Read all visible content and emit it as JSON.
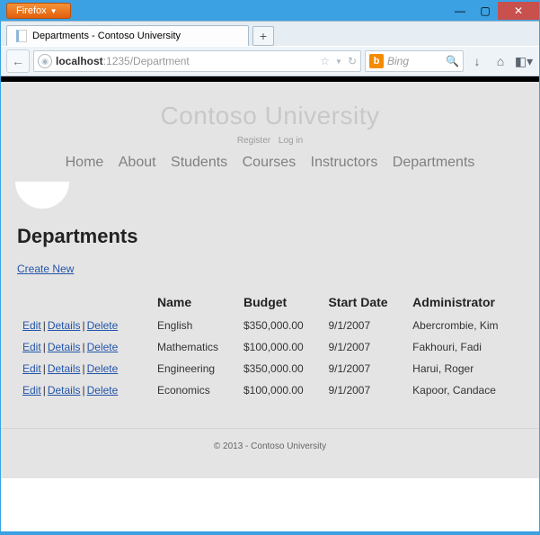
{
  "browser": {
    "menu_label": "Firefox",
    "tab_title": "Departments - Contoso University",
    "url_host": "localhost",
    "url_path": ":1235/Department",
    "search_placeholder": "Bing",
    "newtab_label": "+"
  },
  "site": {
    "title": "Contoso University",
    "auth": {
      "register": "Register",
      "login": "Log in"
    },
    "nav": [
      "Home",
      "About",
      "Students",
      "Courses",
      "Instructors",
      "Departments"
    ]
  },
  "page": {
    "heading": "Departments",
    "create_label": "Create New",
    "columns": [
      "Name",
      "Budget",
      "Start Date",
      "Administrator"
    ],
    "actions": {
      "edit": "Edit",
      "details": "Details",
      "delete": "Delete"
    },
    "rows": [
      {
        "name": "English",
        "budget": "$350,000.00",
        "start": "9/1/2007",
        "admin": "Abercrombie, Kim"
      },
      {
        "name": "Mathematics",
        "budget": "$100,000.00",
        "start": "9/1/2007",
        "admin": "Fakhouri, Fadi"
      },
      {
        "name": "Engineering",
        "budget": "$350,000.00",
        "start": "9/1/2007",
        "admin": "Harui, Roger"
      },
      {
        "name": "Economics",
        "budget": "$100,000.00",
        "start": "9/1/2007",
        "admin": "Kapoor, Candace"
      }
    ]
  },
  "footer": "© 2013 - Contoso University"
}
